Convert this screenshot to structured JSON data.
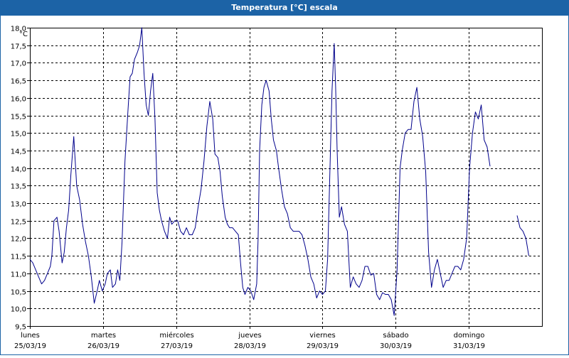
{
  "window": {
    "title": "Temperatura [°C] escala"
  },
  "chart_data": {
    "type": "line",
    "ylabel": "°C",
    "ylim": [
      9.5,
      18.0
    ],
    "yticks": [
      "9,5",
      "10,0",
      "10,5",
      "11,0",
      "11,5",
      "12,0",
      "12,5",
      "13,0",
      "13,5",
      "14,0",
      "14,5",
      "15,0",
      "15,5",
      "16,0",
      "16,5",
      "17,0",
      "17,5",
      "18,0"
    ],
    "xlim": [
      0,
      7
    ],
    "day_labels": [
      {
        "day": "lunes",
        "date": "25/03/19"
      },
      {
        "day": "martes",
        "date": "26/03/19"
      },
      {
        "day": "miércoles",
        "date": "27/03/19"
      },
      {
        "day": "jueves",
        "date": "28/03/19"
      },
      {
        "day": "viernes",
        "date": "29/03/19"
      },
      {
        "day": "sábado",
        "date": "30/03/19"
      },
      {
        "day": "domingo",
        "date": "31/03/19"
      }
    ],
    "grid": true,
    "line_color": "#00008b",
    "series": [
      {
        "segments": [
          [
            [
              0.0,
              11.4
            ],
            [
              0.04,
              11.3
            ],
            [
              0.08,
              11.1
            ],
            [
              0.12,
              10.9
            ],
            [
              0.16,
              10.7
            ],
            [
              0.2,
              10.8
            ],
            [
              0.24,
              11.0
            ],
            [
              0.28,
              11.2
            ],
            [
              0.3,
              11.5
            ],
            [
              0.33,
              12.5
            ],
            [
              0.37,
              12.6
            ],
            [
              0.4,
              12.2
            ],
            [
              0.44,
              11.3
            ],
            [
              0.47,
              11.6
            ],
            [
              0.5,
              12.3
            ],
            [
              0.53,
              12.8
            ],
            [
              0.56,
              13.8
            ],
            [
              0.6,
              14.9
            ],
            [
              0.64,
              13.5
            ],
            [
              0.68,
              13.1
            ],
            [
              0.72,
              12.4
            ],
            [
              0.76,
              11.9
            ],
            [
              0.8,
              11.5
            ],
            [
              0.84,
              10.9
            ],
            [
              0.88,
              10.15
            ],
            [
              0.92,
              10.5
            ],
            [
              0.95,
              10.8
            ],
            [
              0.99,
              10.5
            ],
            [
              1.03,
              10.7
            ],
            [
              1.06,
              11.0
            ],
            [
              1.1,
              11.1
            ],
            [
              1.13,
              10.6
            ],
            [
              1.17,
              10.7
            ],
            [
              1.2,
              11.1
            ],
            [
              1.23,
              10.8
            ],
            [
              1.26,
              11.9
            ],
            [
              1.3,
              14.2
            ],
            [
              1.34,
              15.6
            ],
            [
              1.37,
              16.6
            ],
            [
              1.4,
              16.7
            ],
            [
              1.43,
              17.1
            ],
            [
              1.47,
              17.3
            ],
            [
              1.5,
              17.5
            ],
            [
              1.53,
              18.0
            ],
            [
              1.56,
              16.7
            ],
            [
              1.59,
              15.8
            ],
            [
              1.62,
              15.5
            ],
            [
              1.65,
              16.2
            ],
            [
              1.68,
              16.7
            ],
            [
              1.71,
              15.4
            ],
            [
              1.74,
              13.3
            ],
            [
              1.77,
              12.8
            ],
            [
              1.8,
              12.5
            ],
            [
              1.84,
              12.2
            ],
            [
              1.88,
              12.0
            ],
            [
              1.91,
              12.6
            ],
            [
              1.94,
              12.4
            ],
            [
              1.98,
              12.5
            ],
            [
              2.02,
              12.5
            ],
            [
              2.06,
              12.2
            ],
            [
              2.1,
              12.1
            ],
            [
              2.14,
              12.3
            ],
            [
              2.18,
              12.1
            ],
            [
              2.22,
              12.1
            ],
            [
              2.26,
              12.3
            ],
            [
              2.3,
              12.9
            ],
            [
              2.34,
              13.4
            ],
            [
              2.38,
              14.2
            ],
            [
              2.42,
              15.2
            ],
            [
              2.46,
              15.9
            ],
            [
              2.5,
              15.4
            ],
            [
              2.53,
              14.4
            ],
            [
              2.57,
              14.3
            ],
            [
              2.6,
              13.9
            ],
            [
              2.63,
              13.2
            ],
            [
              2.67,
              12.6
            ],
            [
              2.7,
              12.4
            ],
            [
              2.73,
              12.3
            ],
            [
              2.77,
              12.3
            ],
            [
              2.81,
              12.2
            ],
            [
              2.85,
              12.1
            ],
            [
              2.88,
              11.3
            ],
            [
              2.91,
              10.6
            ],
            [
              2.94,
              10.4
            ],
            [
              2.98,
              10.6
            ],
            [
              3.02,
              10.5
            ],
            [
              3.06,
              10.25
            ],
            [
              3.1,
              10.7
            ],
            [
              3.12,
              12.0
            ],
            [
              3.14,
              14.5
            ],
            [
              3.17,
              15.8
            ],
            [
              3.2,
              16.3
            ],
            [
              3.23,
              16.5
            ],
            [
              3.27,
              16.2
            ],
            [
              3.3,
              15.4
            ],
            [
              3.33,
              14.8
            ],
            [
              3.37,
              14.5
            ],
            [
              3.4,
              14.0
            ],
            [
              3.44,
              13.4
            ],
            [
              3.48,
              12.9
            ],
            [
              3.52,
              12.7
            ],
            [
              3.56,
              12.3
            ],
            [
              3.6,
              12.2
            ],
            [
              3.64,
              12.2
            ],
            [
              3.68,
              12.2
            ],
            [
              3.72,
              12.1
            ],
            [
              3.76,
              11.8
            ],
            [
              3.8,
              11.4
            ],
            [
              3.84,
              10.9
            ],
            [
              3.88,
              10.7
            ],
            [
              3.92,
              10.3
            ],
            [
              3.96,
              10.5
            ],
            [
              4.0,
              10.4
            ],
            [
              4.04,
              10.5
            ],
            [
              4.07,
              11.4
            ],
            [
              4.1,
              13.8
            ],
            [
              4.13,
              16.2
            ],
            [
              4.16,
              17.55
            ],
            [
              4.18,
              16.3
            ],
            [
              4.2,
              14.5
            ],
            [
              4.23,
              12.6
            ],
            [
              4.26,
              12.9
            ],
            [
              4.3,
              12.4
            ],
            [
              4.34,
              12.2
            ],
            [
              4.38,
              10.6
            ],
            [
              4.42,
              10.9
            ],
            [
              4.46,
              10.7
            ],
            [
              4.5,
              10.6
            ],
            [
              4.54,
              10.8
            ],
            [
              4.58,
              11.2
            ],
            [
              4.62,
              11.2
            ],
            [
              4.66,
              10.95
            ],
            [
              4.7,
              11.0
            ],
            [
              4.74,
              10.4
            ],
            [
              4.78,
              10.25
            ],
            [
              4.82,
              10.45
            ],
            [
              4.86,
              10.4
            ],
            [
              4.9,
              10.4
            ],
            [
              4.94,
              10.25
            ],
            [
              4.98,
              9.8
            ],
            [
              5.02,
              11.1
            ],
            [
              5.06,
              14.0
            ],
            [
              5.09,
              14.5
            ],
            [
              5.13,
              15.0
            ],
            [
              5.17,
              15.1
            ],
            [
              5.21,
              15.1
            ],
            [
              5.25,
              15.9
            ],
            [
              5.29,
              16.3
            ],
            [
              5.33,
              15.4
            ],
            [
              5.37,
              14.9
            ],
            [
              5.41,
              13.9
            ],
            [
              5.45,
              11.6
            ],
            [
              5.49,
              10.6
            ],
            [
              5.53,
              11.1
            ],
            [
              5.57,
              11.4
            ],
            [
              5.61,
              11.0
            ],
            [
              5.65,
              10.6
            ],
            [
              5.69,
              10.8
            ],
            [
              5.73,
              10.8
            ],
            [
              5.77,
              11.0
            ],
            [
              5.81,
              11.2
            ],
            [
              5.85,
              11.2
            ],
            [
              5.89,
              11.1
            ],
            [
              5.93,
              11.4
            ],
            [
              5.97,
              12.0
            ],
            [
              6.01,
              14.0
            ],
            [
              6.05,
              15.0
            ],
            [
              6.09,
              15.6
            ],
            [
              6.13,
              15.4
            ],
            [
              6.17,
              15.8
            ],
            [
              6.21,
              14.8
            ],
            [
              6.25,
              14.6
            ],
            [
              6.29,
              14.05
            ]
          ],
          [
            [
              6.66,
              12.65
            ],
            [
              6.7,
              12.3
            ],
            [
              6.74,
              12.2
            ],
            [
              6.78,
              12.0
            ],
            [
              6.82,
              11.5
            ]
          ]
        ]
      }
    ]
  }
}
